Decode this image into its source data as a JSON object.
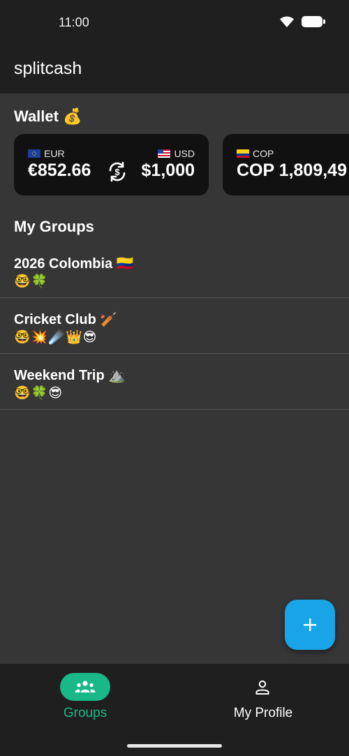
{
  "status_bar": {
    "time": "11:00"
  },
  "app": {
    "title": "splitcash"
  },
  "wallet": {
    "title": "Wallet 💰",
    "cards": [
      {
        "from_code": "EUR",
        "from_amount": "€852.66",
        "to_code": "USD",
        "to_amount": "$1,000"
      },
      {
        "code": "COP",
        "amount": "COP 1,809,49"
      }
    ]
  },
  "groups": {
    "title": "My Groups",
    "items": [
      {
        "name": "2026 Colombia 🇨🇴",
        "members": "🤓🍀"
      },
      {
        "name": "Cricket Club 🏏",
        "members": "🤓💥☄️👑😎"
      },
      {
        "name": "Weekend Trip ⛰️",
        "members": "🤓🍀😎"
      }
    ]
  },
  "fab": {
    "label": "+"
  },
  "nav": {
    "items": [
      {
        "label": "Groups",
        "active": true,
        "icon": "groups-icon"
      },
      {
        "label": "My Profile",
        "active": false,
        "icon": "person-icon"
      }
    ]
  },
  "colors": {
    "accent": "#1ab887",
    "fab": "#18a4e6",
    "background": "#363636",
    "bar": "#1f1f1f",
    "card": "#111111"
  }
}
